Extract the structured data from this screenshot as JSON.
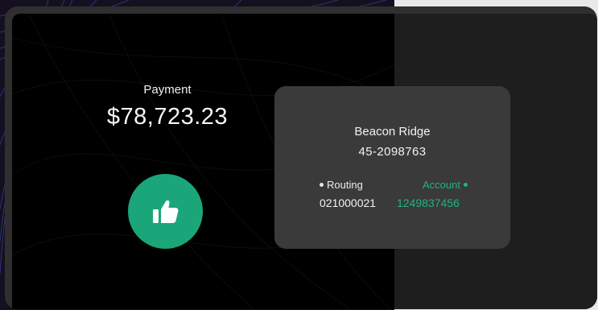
{
  "payment": {
    "label": "Payment",
    "amount": "$78,723.23"
  },
  "approve_button": {
    "icon": "thumbs-up-icon"
  },
  "recipient_card": {
    "company_name": "Beacon Ridge",
    "ein": "45-2098763",
    "routing": {
      "label": "Routing",
      "value": "021000021"
    },
    "account": {
      "label": "Account",
      "value": "1249837456"
    }
  },
  "colors": {
    "accent_green": "#1aa679",
    "account_text_green": "#1fb383",
    "background": "#000000",
    "card": "#3a3a3a"
  }
}
